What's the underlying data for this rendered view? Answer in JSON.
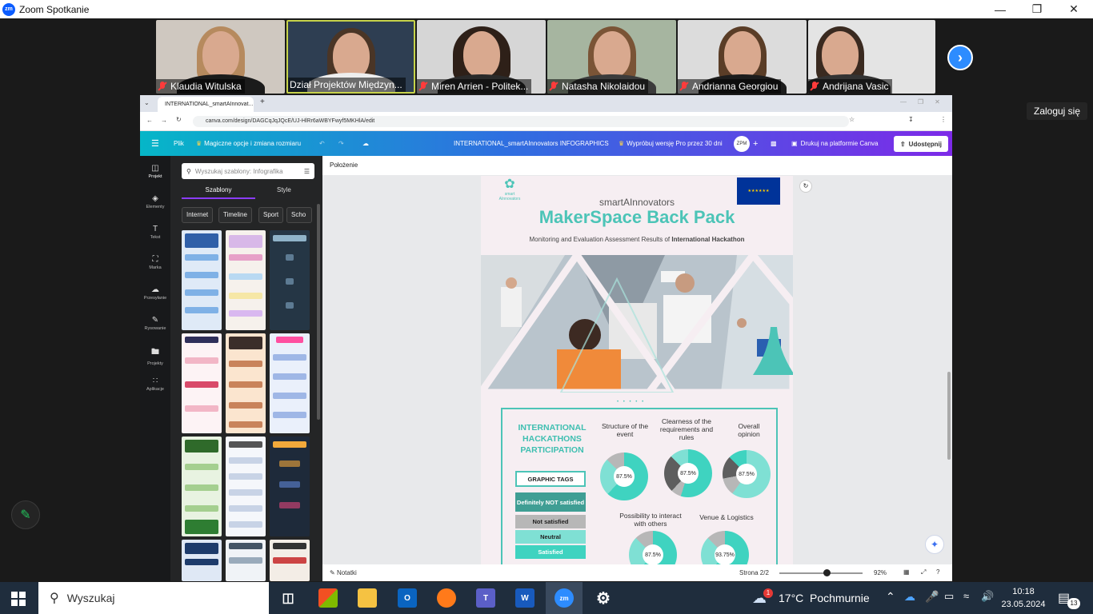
{
  "zoom": {
    "title": "Zoom Spotkanie",
    "logo": "zm",
    "sign_in": "Zaloguj się",
    "participants": [
      {
        "name": "Klaudia Witulska"
      },
      {
        "name": "Dział Projektów Międzyn..."
      },
      {
        "name": "Miren Arrien - Politek..."
      },
      {
        "name": "Natasha Nikolaidou"
      },
      {
        "name": "Andrianna Georgiou"
      },
      {
        "name": "Andrijana Vasic"
      }
    ]
  },
  "browser": {
    "tab_title": "INTERNATIONAL_smartAInnovat...",
    "url": "canva.com/design/DAGCqJqJQcE/UJ-HlRr6aWBYFwyf5MKHlA/edit"
  },
  "canva": {
    "menu_file": "Plik",
    "magic": "Magiczne opcje i zmiana rozmiaru",
    "doc_title": "INTERNATIONAL_smartAInnovators INFOGRAPHICS",
    "pro_trial": "Wypróbuj wersję Pro przez 30 dni",
    "avatar": "ZPM",
    "print": "Drukuj na platformie Canva",
    "share": "Udostępnij",
    "rail": [
      {
        "label": "Projekt"
      },
      {
        "label": "Elementy"
      },
      {
        "label": "Tekst"
      },
      {
        "label": "Marka"
      },
      {
        "label": "Przesyłanie"
      },
      {
        "label": "Rysowanie"
      },
      {
        "label": "Projekty"
      },
      {
        "label": "Aplikacje"
      }
    ],
    "search_placeholder": "Wyszukaj szablony: Infografika",
    "panel_tabs": [
      "Szablony",
      "Style"
    ],
    "chips": [
      "Internet",
      "Timeline",
      "Sport",
      "Scho"
    ],
    "position_label": "Położenie",
    "notes": "Notatki",
    "page_indicator": "Strona 2/2",
    "zoom_level": "92%"
  },
  "infographic": {
    "brand": "smartAInnovators",
    "logo_text": "smart AInnovators",
    "title": "MakerSpace Back Pack",
    "subtitle_pre": "Monitoring and Evaluation Assessment Results of ",
    "subtitle_bold": "International Hackathon",
    "section_title": "INTERNATIONAL HACKATHONS PARTICIPATION",
    "tags_title": "GRAPHIC TAGS",
    "legend": [
      {
        "label": "Definitely NOT satisfied",
        "color": "#3f9e94"
      },
      {
        "label": "Not satisfied",
        "color": "#b7b7b7"
      },
      {
        "label": "Neutral",
        "color": "#7fe0d4"
      },
      {
        "label": "Satisfied",
        "color": "#3fd3c0"
      }
    ],
    "questions": [
      {
        "label": "Structure of the event",
        "value": "87.5%"
      },
      {
        "label": "Clearness of the requirements and rules",
        "value": "87.5%"
      },
      {
        "label": "Overall opinion",
        "value": "87.5%"
      },
      {
        "label": "Possibility to interact with others",
        "value": "87.5%"
      },
      {
        "label": "Venue & Logistics",
        "value": "93.75%"
      }
    ]
  },
  "taskbar": {
    "search": "Wyszukaj",
    "weather_temp": "17°C",
    "weather_desc": "Pochmurnie",
    "weather_badge": "1",
    "time": "10:18",
    "date": "23.05.2024",
    "notif_count": "13"
  }
}
